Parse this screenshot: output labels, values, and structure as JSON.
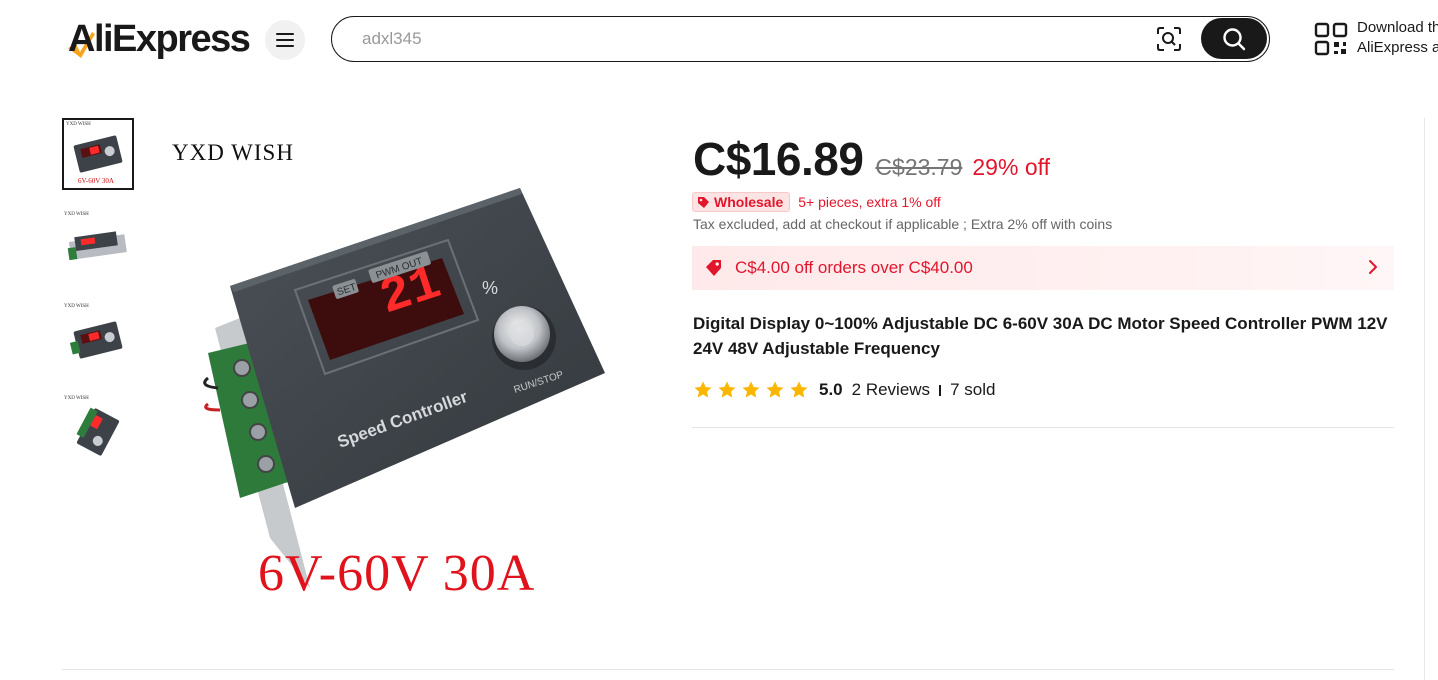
{
  "header": {
    "logo_text": "AliExpress",
    "search": {
      "value": "adxl345"
    },
    "download": {
      "line1": "Download the",
      "line2": "AliExpress app"
    }
  },
  "gallery": {
    "thumbnails": [
      {
        "watermark": "YXD WISH",
        "caption": "6V-60V 30A",
        "active": true
      },
      {
        "watermark": "YXD WISH",
        "active": false
      },
      {
        "watermark": "YXD WISH",
        "active": false
      },
      {
        "watermark": "YXD WISH",
        "active": false
      }
    ],
    "main": {
      "brand": "YXD WISH",
      "spec": "6V-60V 30A",
      "device": {
        "set_label": "SET",
        "pwm_label": "PWM OUT",
        "display_value": "21",
        "percent": "%",
        "knob_label": "RUN/STOP",
        "name": "Speed Controller"
      }
    }
  },
  "product": {
    "price": "C$16.89",
    "original_price": "C$23.79",
    "discount": "29% off",
    "wholesale": {
      "badge": "Wholesale",
      "text": "5+ pieces, extra 1% off"
    },
    "tax_note": "Tax excluded, add at checkout if applicable ; Extra 2% off with coins",
    "coupon": "C$4.00 off orders over C$40.00",
    "title": "Digital Display 0~100% Adjustable DC 6-60V 30A DC Motor Speed Controller PWM 12V 24V 48V Adjustable Frequency",
    "rating": {
      "score": "5.0",
      "stars": 5,
      "reviews": "2 Reviews",
      "sold": "7 sold"
    }
  },
  "colors": {
    "accent_red": "#e1162c",
    "text_dark": "#191919",
    "star_gold": "#fdb600",
    "logo_orange": "#f7a31b"
  },
  "icons": {
    "menu": "menu-icon",
    "camera": "image-search-icon",
    "search": "search-icon",
    "qr": "qr-code-icon",
    "wholesale": "wholesale-tag-icon",
    "coupon": "coupon-tag-icon",
    "coupon_arrow": "chevron-right-icon",
    "star": "star-icon"
  }
}
